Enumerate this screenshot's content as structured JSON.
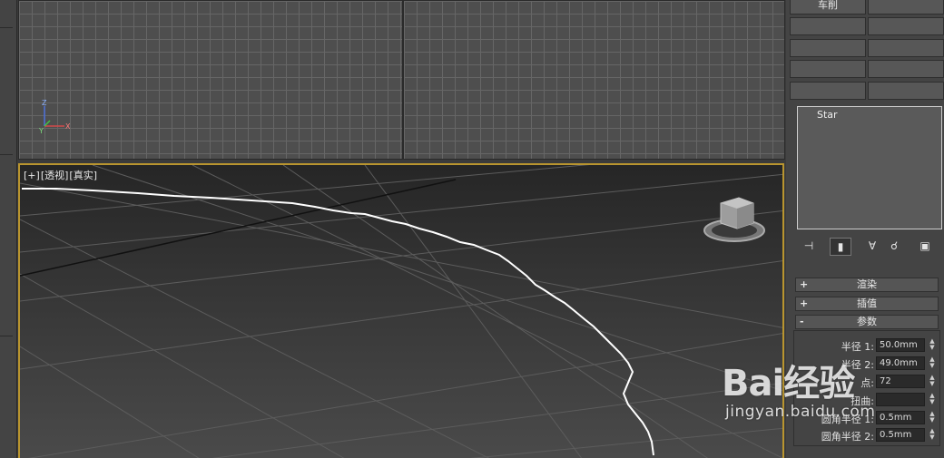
{
  "viewport": {
    "label_plus": "[+]",
    "label_view": "[透视]",
    "label_shading": "[真实]"
  },
  "axis": {
    "x": "X",
    "y": "Y",
    "z": "Z"
  },
  "command_panel": {
    "top_button": "车削",
    "object_name": "Star",
    "rollouts": [
      {
        "sign": "+",
        "label": "渲染"
      },
      {
        "sign": "+",
        "label": "插值"
      },
      {
        "sign": "-",
        "label": "参数"
      }
    ],
    "params": [
      {
        "label": "半径 1:",
        "value": "50.0mm"
      },
      {
        "label": "半径 2:",
        "value": "49.0mm"
      },
      {
        "label": "点:",
        "value": "72"
      },
      {
        "label": "扭曲:",
        "value": ""
      },
      {
        "label": "圆角半径 1:",
        "value": "0.5mm"
      },
      {
        "label": "圆角半径 2:",
        "value": "0.5mm"
      }
    ]
  },
  "watermark": {
    "logo": "Bai经验",
    "url": "jingyan.baidu.com"
  },
  "colors": {
    "active_border": "#b9952f",
    "spline": "#ffffff",
    "grid": "#666666"
  }
}
